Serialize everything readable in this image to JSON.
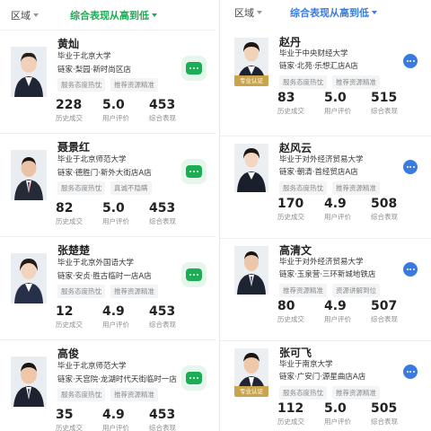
{
  "left": {
    "filter": {
      "region": "区域",
      "sort": "综合表现从高到低"
    },
    "agents": [
      {
        "name": "黄灿",
        "school": "毕业于北京大学",
        "store": "链家·梨园·新时尚区店",
        "tags": [
          "服务态度热忱",
          "推荐资源精准"
        ],
        "stats": [
          {
            "value": "228",
            "label": "历史成交"
          },
          {
            "value": "5.0",
            "label": "用户评价"
          },
          {
            "value": "453",
            "label": "综合表现"
          }
        ]
      },
      {
        "name": "聂景红",
        "school": "毕业于北京师范大学",
        "store": "链家·德胜门·新外大街店A店",
        "tags": [
          "服务态度热忱",
          "真诚不隐瞒"
        ],
        "stats": [
          {
            "value": "82",
            "label": "历史成交"
          },
          {
            "value": "5.0",
            "label": "用户评价"
          },
          {
            "value": "453",
            "label": "综合表现"
          }
        ]
      },
      {
        "name": "张楚楚",
        "school": "毕业于北京外国语大学",
        "store": "链家·安贞·胜古临时一店A店",
        "tags": [
          "服务态度热忱",
          "推荐资源精准"
        ],
        "stats": [
          {
            "value": "12",
            "label": "历史成交"
          },
          {
            "value": "4.9",
            "label": "用户评价"
          },
          {
            "value": "453",
            "label": "综合表现"
          }
        ]
      },
      {
        "name": "高俊",
        "school": "毕业于北京师范大学",
        "store": "链家·天宫院·龙湖时代天街临时一店",
        "tags": [
          "服务态度热忱",
          "推荐资源精准"
        ],
        "stats": [
          {
            "value": "35",
            "label": "历史成交"
          },
          {
            "value": "4.9",
            "label": "用户评价"
          },
          {
            "value": "453",
            "label": "综合表现"
          }
        ]
      }
    ]
  },
  "right": {
    "filter": {
      "region": "区域",
      "sort": "综合表现从高到低"
    },
    "agents": [
      {
        "name": "赵丹",
        "school": "毕业于中央财经大学",
        "store": "链家·北苑·乐想汇店A店",
        "tags": [
          "服务态度热忱",
          "推荐资源精准"
        ],
        "cert": "专业认证",
        "stats": [
          {
            "value": "83",
            "label": "历史成交"
          },
          {
            "value": "5.0",
            "label": "用户评价"
          },
          {
            "value": "515",
            "label": "综合表现"
          }
        ]
      },
      {
        "name": "赵风云",
        "school": "毕业于对外经济贸易大学",
        "store": "链家·朝清·首经贸店A店",
        "tags": [
          "服务态度热忱",
          "推荐资源精准"
        ],
        "stats": [
          {
            "value": "170",
            "label": "历史成交"
          },
          {
            "value": "4.9",
            "label": "用户评价"
          },
          {
            "value": "508",
            "label": "综合表现"
          }
        ]
      },
      {
        "name": "高清文",
        "school": "毕业于对外经济贸易大学",
        "store": "链家·玉泉营·三环新城地铁店",
        "tags": [
          "推荐资源精准",
          "资源讲解到位"
        ],
        "stats": [
          {
            "value": "80",
            "label": "历史成交"
          },
          {
            "value": "4.9",
            "label": "用户评价"
          },
          {
            "value": "507",
            "label": "综合表现"
          }
        ]
      },
      {
        "name": "张可飞",
        "school": "毕业于南京大学",
        "store": "链家·广安门·源星曲店A店",
        "tags": [
          "服务态度热忱",
          "推荐资源精准"
        ],
        "cert": "专业认证",
        "stats": [
          {
            "value": "112",
            "label": "历史成交"
          },
          {
            "value": "5.0",
            "label": "用户评价"
          },
          {
            "value": "505",
            "label": "综合表现"
          }
        ]
      }
    ]
  },
  "colors": {
    "green_accent": "#1aad53",
    "blue_accent": "#3b7be0",
    "cert_gold": "#c9a44c"
  },
  "icons": {
    "chat_left": "chat-bubble-icon",
    "chat_right": "chat-dots-icon",
    "dropdown": "caret-down-icon"
  }
}
